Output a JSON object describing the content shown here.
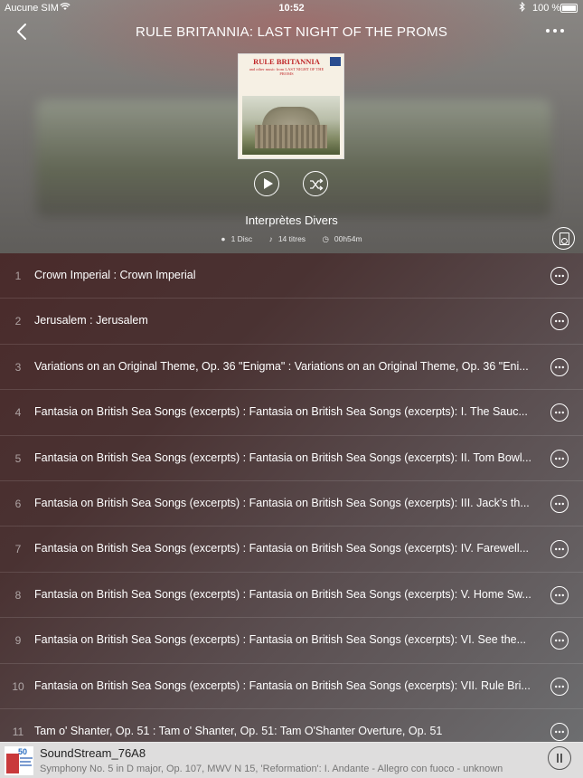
{
  "status_bar": {
    "carrier": "Aucune SIM",
    "time": "10:52",
    "battery": "100 %"
  },
  "nav": {
    "title": "RULE BRITANNIA: LAST NIGHT OF THE PROMS",
    "back_icon": "chevron-left-icon",
    "more_icon": "more-horizontal-icon"
  },
  "album": {
    "cover_title": "RULE BRITANNIA",
    "cover_subtitle": "and other music from LAST NIGHT OF THE PROMS",
    "artist": "Interprètes Divers",
    "discs": "1 Disc",
    "tracks_count": "14 titres",
    "duration": "00h54m"
  },
  "tracks": [
    {
      "num": "1",
      "title": "Crown Imperial : Crown Imperial"
    },
    {
      "num": "2",
      "title": "Jerusalem : Jerusalem"
    },
    {
      "num": "3",
      "title": "Variations on an Original Theme, Op. 36 \"Enigma\" : Variations on an Original Theme, Op. 36 \"Eni..."
    },
    {
      "num": "4",
      "title": "Fantasia on British Sea Songs (excerpts) : Fantasia on British Sea Songs (excerpts): I. The Sauc..."
    },
    {
      "num": "5",
      "title": "Fantasia on British Sea Songs (excerpts) : Fantasia on British Sea Songs (excerpts): II. Tom Bowl..."
    },
    {
      "num": "6",
      "title": "Fantasia on British Sea Songs (excerpts) : Fantasia on British Sea Songs (excerpts): III. Jack's th..."
    },
    {
      "num": "7",
      "title": "Fantasia on British Sea Songs (excerpts) : Fantasia on British Sea Songs (excerpts): IV. Farewell..."
    },
    {
      "num": "8",
      "title": "Fantasia on British Sea Songs (excerpts) : Fantasia on British Sea Songs (excerpts): V. Home Sw..."
    },
    {
      "num": "9",
      "title": "Fantasia on British Sea Songs (excerpts) : Fantasia on British Sea Songs (excerpts): VI. See the..."
    },
    {
      "num": "10",
      "title": "Fantasia on British Sea Songs (excerpts) : Fantasia on British Sea Songs (excerpts): VII. Rule Bri..."
    },
    {
      "num": "11",
      "title": "Tam o' Shanter, Op. 51 : Tam o' Shanter, Op. 51: Tam O'Shanter Overture, Op. 51"
    }
  ],
  "mini_player": {
    "art_label": "50",
    "device": "SoundStream_76A8",
    "track": "Symphony No. 5 in D major, Op. 107, MWV N 15, 'Reformation': I. Andante - Allegro con fuoco - unknown"
  }
}
